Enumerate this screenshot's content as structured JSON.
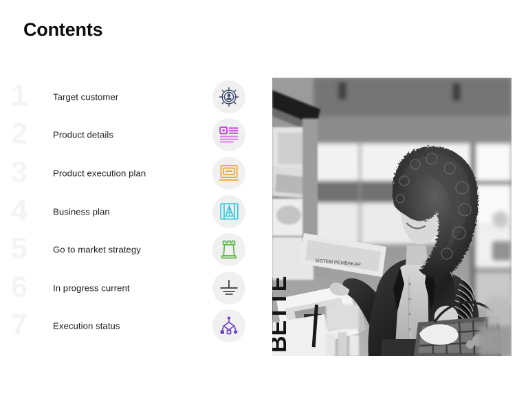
{
  "slide": {
    "title": "Contents",
    "background_color": "#ffffff"
  },
  "colors": {
    "title_text": "#0d0d0d",
    "item_text": "#1b1b1b",
    "item_number": "#f4f4f4",
    "icon_circle_bg": "#f0f0f0"
  },
  "contents": {
    "items": [
      {
        "number": "1",
        "label": "Target customer",
        "icon": "target-person-icon",
        "icon_color": "#3c4a6b"
      },
      {
        "number": "2",
        "label": "Product details",
        "icon": "article-layout-icon",
        "icon_color": "#c049d4"
      },
      {
        "number": "3",
        "label": "Product execution plan",
        "icon": "laptop-screen-icon",
        "icon_color": "#e8a93a"
      },
      {
        "number": "4",
        "label": "Business plan",
        "icon": "blueprint-drafting-icon",
        "icon_color": "#35c9e0"
      },
      {
        "number": "5",
        "label": "Go to market strategy",
        "icon": "chess-rook-icon",
        "icon_color": "#63b84f"
      },
      {
        "number": "6",
        "label": "In progress current",
        "icon": "ground-symbol-icon",
        "icon_color": "#3b3b3b"
      },
      {
        "number": "7",
        "label": "Execution status",
        "icon": "flowchart-decision-icon",
        "icon_color": "#6b3fc4"
      }
    ]
  },
  "photo": {
    "name": "woman-shopping-grayscale-photo",
    "description": "Black and white photograph of a woman with curly hair shopping in a store, holding a package and a shopping basket",
    "visible_text": "BETTER"
  }
}
